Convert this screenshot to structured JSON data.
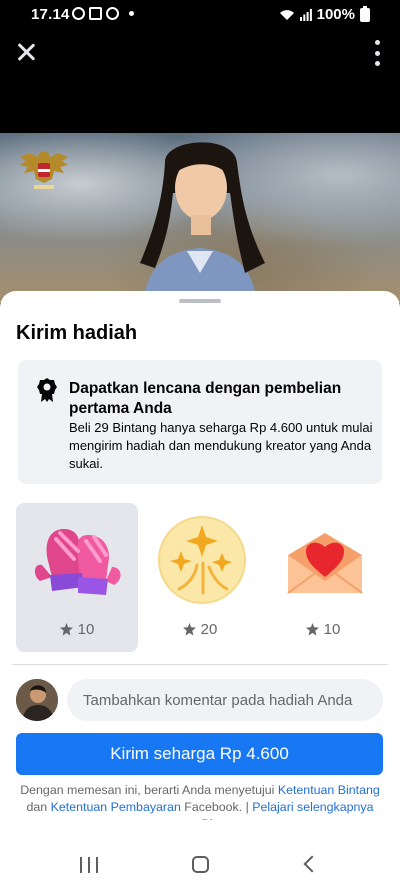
{
  "status_bar": {
    "time": "17.14",
    "battery": "100%"
  },
  "sheet": {
    "title": "Kirim hadiah"
  },
  "promo": {
    "heading": "Dapatkan lencana dengan pembelian pertama Anda",
    "body": "Beli 29 Bintang hanya seharga Rp 4.600 untuk mulai mengirim hadiah dan mendukung kreator yang Anda sukai."
  },
  "gifts": [
    {
      "icon": "mittens-icon",
      "price": "10",
      "selected": true
    },
    {
      "icon": "sparkles-icon",
      "price": "20",
      "selected": false
    },
    {
      "icon": "heart-envelope-icon",
      "price": "10",
      "selected": false
    }
  ],
  "comment": {
    "placeholder": "Tambahkan komentar pada hadiah Anda"
  },
  "send_button": {
    "label": "Kirim seharga Rp 4.600"
  },
  "terms": {
    "prefix": "Dengan memesan ini, berarti Anda menyetujui ",
    "link1": "Ketentuan Bintang",
    "mid": " dan ",
    "link2": "Ketentuan Pembayaran",
    "suffix": " Facebook. | ",
    "link3": "Pelajari selengkapnya tentang Bintang"
  },
  "colors": {
    "accent": "#1877f2",
    "link": "#216fdb",
    "selected_bg": "#e4e6eb",
    "card_bg": "#f0f2f5"
  }
}
